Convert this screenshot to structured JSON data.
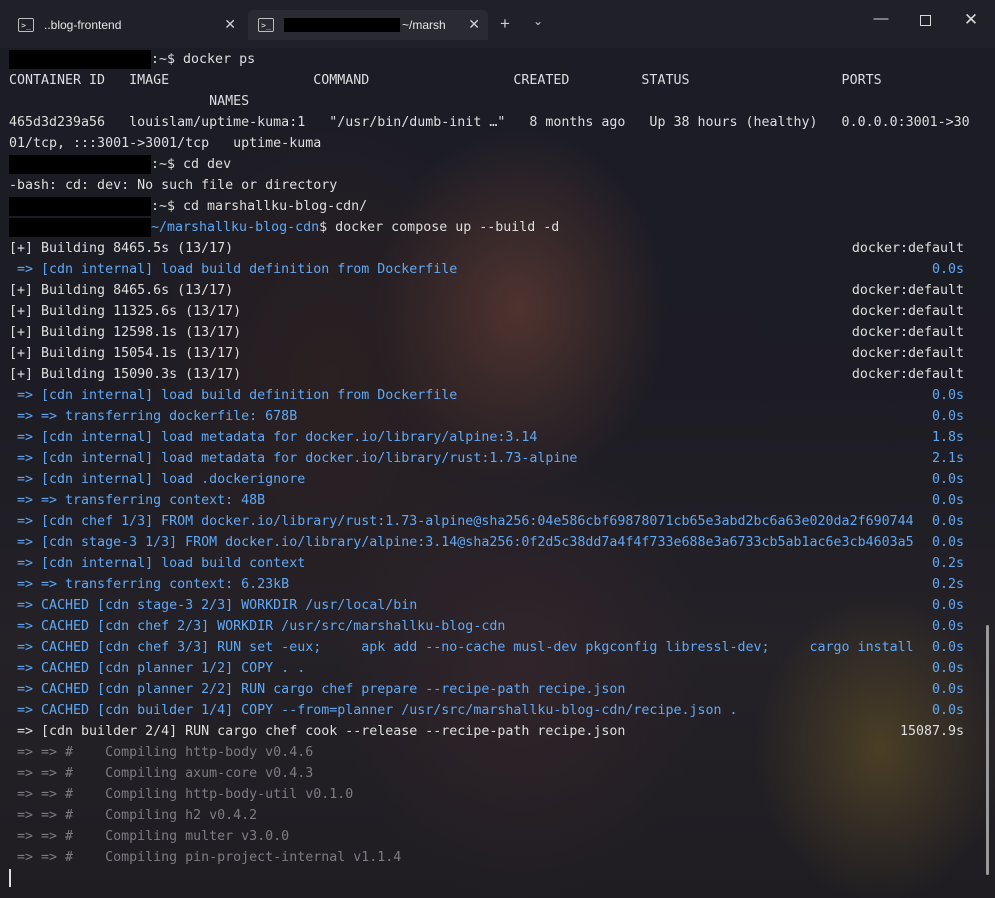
{
  "tabs": [
    {
      "title": "..blog-frontend",
      "icon": "powershell-icon"
    },
    {
      "title": "~/marsh",
      "icon": "powershell-icon"
    }
  ],
  "tabbar": {
    "new_tab": "+",
    "dropdown": "⌄"
  },
  "window_controls": {
    "minimize": "—",
    "maximize": "",
    "close": "✕"
  },
  "terminal": {
    "prompt_suffix": ":~$",
    "cwd_path": "~/marshallku-blog-cdn",
    "lines": {
      "l1_cmd": " docker ps",
      "l2": "CONTAINER ID   IMAGE                  COMMAND                  CREATED         STATUS                   PORTS",
      "l3": "                         NAMES",
      "l4": "465d3d239a56   louislam/uptime-kuma:1   \"/usr/bin/dumb-init …\"   8 months ago   Up 38 hours (healthy)   0.0.0.0:3001->30",
      "l5": "01/tcp, :::3001->3001/tcp   uptime-kuma",
      "l6_cmd": " cd dev",
      "l7": "-bash: cd: dev: No such file or directory",
      "l8_cmd": " cd marshallku-blog-cdn/",
      "l9_cmd": "$ docker compose up --build -d",
      "b1": "[+] Building 8465.5s (13/17)",
      "b1r": "docker:default",
      "s1": " => [cdn internal] load build definition from Dockerfile",
      "s1r": "0.0s",
      "b2": "[+] Building 8465.6s (13/17)",
      "b2r": "docker:default",
      "b3": "[+] Building 11325.6s (13/17)",
      "b3r": "docker:default",
      "b4": "[+] Building 12598.1s (13/17)",
      "b4r": "docker:default",
      "b5": "[+] Building 15054.1s (13/17)",
      "b5r": "docker:default",
      "b6": "[+] Building 15090.3s (13/17)",
      "b6r": "docker:default",
      "s2": " => [cdn internal] load build definition from Dockerfile",
      "s2r": "0.0s",
      "s3": " => => transferring dockerfile: 678B",
      "s3r": "0.0s",
      "s4": " => [cdn internal] load metadata for docker.io/library/alpine:3.14",
      "s4r": "1.8s",
      "s5": " => [cdn internal] load metadata for docker.io/library/rust:1.73-alpine",
      "s5r": "2.1s",
      "s6": " => [cdn internal] load .dockerignore",
      "s6r": "0.0s",
      "s7": " => => transferring context: 48B",
      "s7r": "0.0s",
      "s8": " => [cdn chef 1/3] FROM docker.io/library/rust:1.73-alpine@sha256:04e586cbf69878071cb65e3abd2bc6a63e020da2f690744",
      "s8r": "0.0s",
      "s9": " => [cdn stage-3 1/3] FROM docker.io/library/alpine:3.14@sha256:0f2d5c38dd7a4f4f733e688e3a6733cb5ab1ac6e3cb4603a5",
      "s9r": "0.0s",
      "s10": " => [cdn internal] load build context",
      "s10r": "0.2s",
      "s11": " => => transferring context: 6.23kB",
      "s11r": "0.2s",
      "s12": " => CACHED [cdn stage-3 2/3] WORKDIR /usr/local/bin",
      "s12r": "0.0s",
      "s13": " => CACHED [cdn chef 2/3] WORKDIR /usr/src/marshallku-blog-cdn",
      "s13r": "0.0s",
      "s14": " => CACHED [cdn chef 3/3] RUN set -eux;     apk add --no-cache musl-dev pkgconfig libressl-dev;     cargo install",
      "s14r": "0.0s",
      "s15": " => CACHED [cdn planner 1/2] COPY . .",
      "s15r": "0.0s",
      "s16": " => CACHED [cdn planner 2/2] RUN cargo chef prepare --recipe-path recipe.json",
      "s16r": "0.0s",
      "s17": " => CACHED [cdn builder 1/4] COPY --from=planner /usr/src/marshallku-blog-cdn/recipe.json .",
      "s17r": "0.0s",
      "w1": " => [cdn builder 2/4] RUN cargo chef cook --release --recipe-path recipe.json",
      "w1r": "15087.9s",
      "g1": " => => #    Compiling http-body v0.4.6",
      "g2": " => => #    Compiling axum-core v0.4.3",
      "g3": " => => #    Compiling http-body-util v0.1.0",
      "g4": " => => #    Compiling h2 v0.4.2",
      "g5": " => => #    Compiling multer v3.0.0",
      "g6": " => => #    Compiling pin-project-internal v1.1.4"
    }
  },
  "colors": {
    "accent_blue": "#5fa8f5",
    "muted_grey": "#7c7c82",
    "text": "#dedede"
  }
}
